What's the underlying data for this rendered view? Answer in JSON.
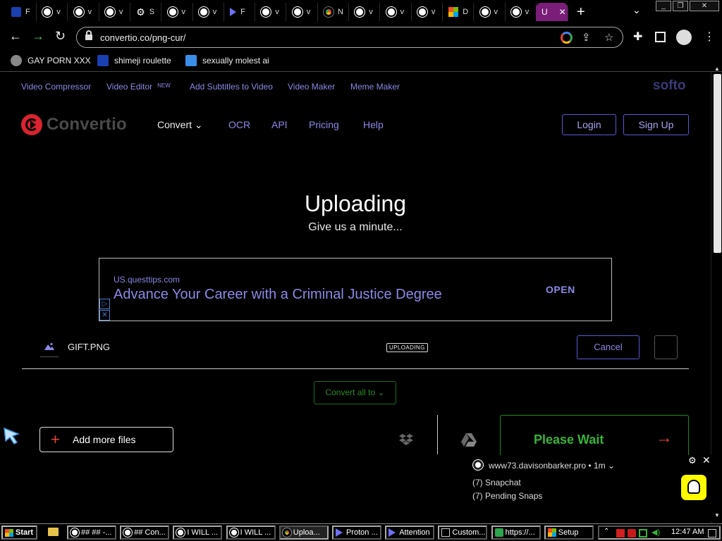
{
  "browser": {
    "tabs": [
      {
        "label": "F",
        "icon": "eu-flag-icon"
      },
      {
        "label": "v",
        "icon": "globe-icon"
      },
      {
        "label": "v",
        "icon": "globe-icon"
      },
      {
        "label": "v",
        "icon": "globe-icon"
      },
      {
        "label": "S",
        "icon": "gear-icon"
      },
      {
        "label": "v",
        "icon": "globe-icon"
      },
      {
        "label": "v",
        "icon": "globe-icon"
      },
      {
        "label": "F",
        "icon": "play-icon"
      },
      {
        "label": "v",
        "icon": "globe-icon"
      },
      {
        "label": "v",
        "icon": "globe-icon"
      },
      {
        "label": "N",
        "icon": "chrome-icon"
      },
      {
        "label": "v",
        "icon": "globe-icon"
      },
      {
        "label": "v",
        "icon": "globe-icon"
      },
      {
        "label": "v",
        "icon": "globe-icon"
      },
      {
        "label": "D",
        "icon": "microsoft-icon"
      },
      {
        "label": "v",
        "icon": "globe-icon"
      },
      {
        "label": "v",
        "icon": "globe-icon"
      }
    ],
    "active_tab": {
      "label": "U"
    },
    "new_tab": "+",
    "tab_search": "⌄",
    "window_buttons": [
      "_",
      "❐",
      "✕"
    ],
    "url": "convertio.co/png-cur/",
    "bookmarks": [
      {
        "label": "GAY PORN XXX"
      },
      {
        "label": "shimeji roulette"
      },
      {
        "label": "sexually molest ai"
      }
    ]
  },
  "site": {
    "topnav": {
      "video_compressor": "Video Compressor",
      "video_editor": "Video Editor",
      "new_badge": "NEW",
      "add_subtitles": "Add Subtitles to Video",
      "video_maker": "Video Maker",
      "meme_maker": "Meme Maker",
      "softo": "softo"
    },
    "logo_text": "Convertio",
    "nav": {
      "convert": "Convert",
      "ocr": "OCR",
      "api": "API",
      "pricing": "Pricing",
      "help": "Help"
    },
    "login": "Login",
    "signup": "Sign Up",
    "title": "Uploading",
    "subtitle": "Give us a minute...",
    "ad": {
      "domain": "US.questtips.com",
      "headline": "Advance Your Career with a Criminal Justice Degree",
      "cta": "OPEN",
      "choices": "▷",
      "close": "✕"
    },
    "file": {
      "name": "GIFT.PNG",
      "status": "UPLOADING",
      "cancel": "Cancel"
    },
    "convert_all": "Convert all to",
    "add_more": "Add more files",
    "please_wait": "Please Wait"
  },
  "notification": {
    "site": "www73.davisonbarker.pro",
    "meta": "• 1m ⌄",
    "title": "(7) Snapchat",
    "body": "(7) Pending Snaps"
  },
  "taskbar": {
    "start": "Start",
    "tasks": [
      {
        "label": "## ## -...",
        "icon": "globe-icon"
      },
      {
        "label": "## Con...",
        "icon": "globe-icon"
      },
      {
        "label": "I WILL ...",
        "icon": "globe-icon"
      },
      {
        "label": "I WILL ...",
        "icon": "globe-icon"
      },
      {
        "label": "Uploa...",
        "icon": "chrome-icon",
        "active": true
      },
      {
        "label": "Proton ...",
        "icon": "triangle-icon"
      },
      {
        "label": "Attention",
        "icon": "triangle-icon"
      },
      {
        "label": "Custom...",
        "icon": "terminal-icon"
      },
      {
        "label": "https://...",
        "icon": "green-icon"
      },
      {
        "label": "Setup",
        "icon": "microsoft-icon"
      }
    ],
    "clock": "12:47 AM"
  },
  "colors": {
    "accent": "#8c88e6",
    "brand_red": "#d9232e",
    "wait_green": "#36b336",
    "active_tab": "#7a1e7a",
    "snap_yellow": "#fffc00"
  }
}
